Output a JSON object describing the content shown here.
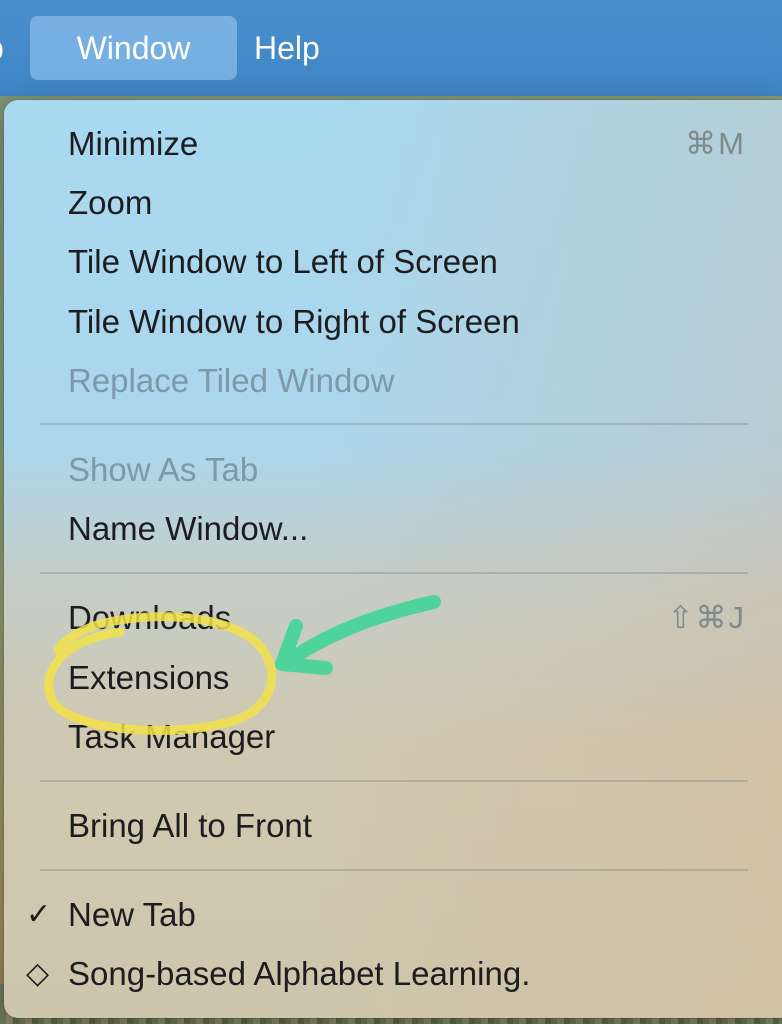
{
  "menubar": {
    "partial_label": "p",
    "window_label": "Window",
    "help_label": "Help"
  },
  "menu": {
    "items": [
      {
        "label": "Minimize",
        "shortcut": "⌘M",
        "enabled": true
      },
      {
        "label": "Zoom",
        "enabled": true
      },
      {
        "label": "Tile Window to Left of Screen",
        "enabled": true
      },
      {
        "label": "Tile Window to Right of Screen",
        "enabled": true
      },
      {
        "label": "Replace Tiled Window",
        "enabled": false
      },
      {
        "label": "Show As Tab",
        "enabled": false
      },
      {
        "label": "Name Window...",
        "enabled": true
      },
      {
        "label": "Downloads",
        "shortcut": "⇧⌘J",
        "enabled": true
      },
      {
        "label": "Extensions",
        "enabled": true
      },
      {
        "label": "Task Manager",
        "enabled": true
      },
      {
        "label": "Bring All to Front",
        "enabled": true
      },
      {
        "label": "New Tab",
        "mark": "✓",
        "enabled": true
      },
      {
        "label": "Song-based Alphabet Learning.",
        "mark": "◇",
        "enabled": true
      }
    ]
  },
  "annotation": {
    "circle_color": "#f2e24a",
    "arrow_color": "#4ed39a",
    "highlight_target": "Extensions"
  }
}
